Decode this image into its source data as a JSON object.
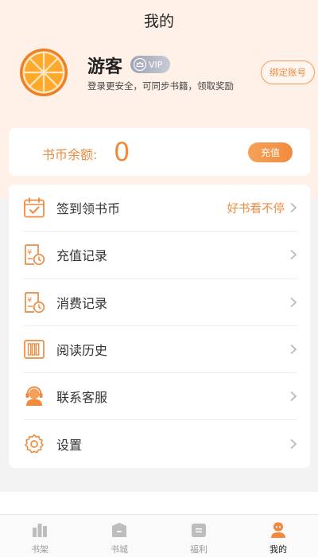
{
  "header": {
    "title": "我的"
  },
  "profile": {
    "username": "游客",
    "vip_label": "VIP",
    "subtitle": "登录更安全，可同步书籍，领取奖励",
    "bind_button": "绑定账号"
  },
  "coins": {
    "label": "书币余额:",
    "value": "0",
    "recharge_button": "充值"
  },
  "menu": {
    "items": [
      {
        "label": "签到领书币",
        "extra": "好书看不停",
        "icon": "calendar-check-icon"
      },
      {
        "label": "充值记录",
        "icon": "receipt-clock-icon"
      },
      {
        "label": "消费记录",
        "icon": "receipt-clock-icon"
      },
      {
        "label": "阅读历史",
        "icon": "books-icon"
      },
      {
        "label": "联系客服",
        "icon": "headset-icon"
      },
      {
        "label": "设置",
        "icon": "gear-icon"
      }
    ]
  },
  "tabbar": {
    "items": [
      {
        "label": "书架",
        "icon": "bookshelf-icon"
      },
      {
        "label": "书城",
        "icon": "bookstore-icon"
      },
      {
        "label": "福利",
        "icon": "welfare-icon"
      },
      {
        "label": "我的",
        "icon": "user-icon",
        "active": true
      }
    ]
  },
  "colors": {
    "accent": "#f08a3e",
    "header_bg": "#fff1e8",
    "page_bg": "#f3f3f3"
  }
}
